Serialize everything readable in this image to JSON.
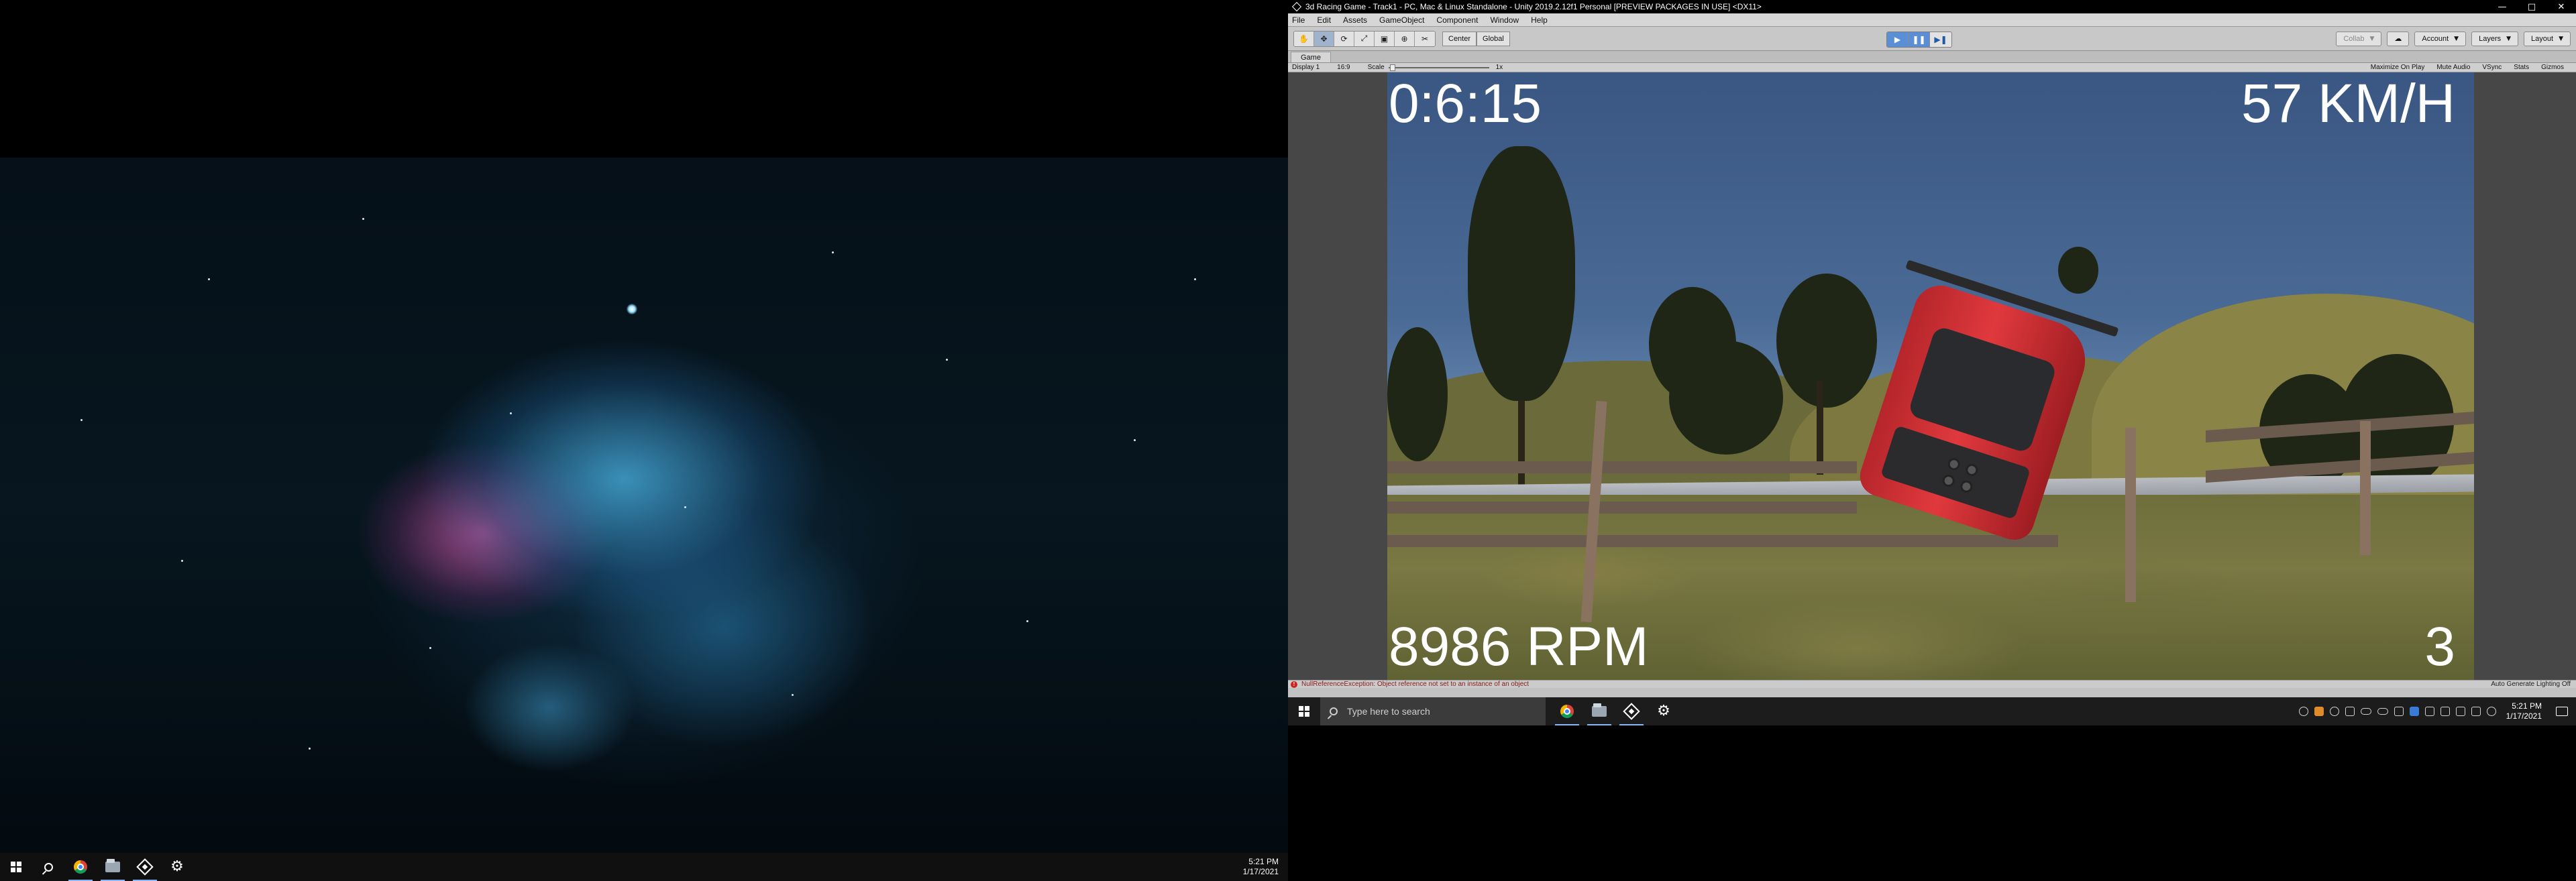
{
  "left_monitor": {
    "taskbar": {
      "clock_time": "5:21 PM",
      "clock_date": "1/17/2021",
      "icons": [
        "windows-start-icon",
        "search-icon",
        "chrome-icon",
        "file-explorer-icon",
        "unity-icon",
        "settings-gear-icon"
      ]
    }
  },
  "unity": {
    "title": "3d Racing Game - Track1 - PC, Mac & Linux Standalone - Unity 2019.2.12f1 Personal [PREVIEW PACKAGES IN USE] <DX11>",
    "window_controls": {
      "minimize": "—",
      "maximize": "□",
      "close": "✕"
    },
    "menu": [
      "File",
      "Edit",
      "Assets",
      "GameObject",
      "Component",
      "Window",
      "Help"
    ],
    "toolbar": {
      "tools": [
        "✋",
        "✥",
        "⟳",
        "⤢",
        "▣",
        "⊕",
        "✂"
      ],
      "pivot": "Center",
      "space": "Global",
      "play": "▶",
      "pause": "❚❚",
      "step": "▶❚",
      "collab": "Collab",
      "account": "Account",
      "layers": "Layers",
      "layout": "Layout"
    },
    "game_tab": "Game",
    "game_bar": {
      "display": "Display 1",
      "aspect": "16:9",
      "scale_label": "Scale",
      "scale_value": "1x",
      "maximize_on_play": "Maximize On Play",
      "mute_audio": "Mute Audio",
      "vsync": "VSync",
      "stats": "Stats",
      "gizmos": "Gizmos"
    },
    "hud": {
      "time": "0:6:15",
      "speed": "57 KM/H",
      "rpm": "8986 RPM",
      "gear": "3"
    },
    "status": {
      "message": "NullReferenceException: Object reference not set to an instance of an object",
      "lighting": "Auto Generate Lighting Off"
    }
  },
  "right_taskbar": {
    "search_placeholder": "Type here to search",
    "clock_time": "5:21 PM",
    "clock_date": "1/17/2021"
  }
}
